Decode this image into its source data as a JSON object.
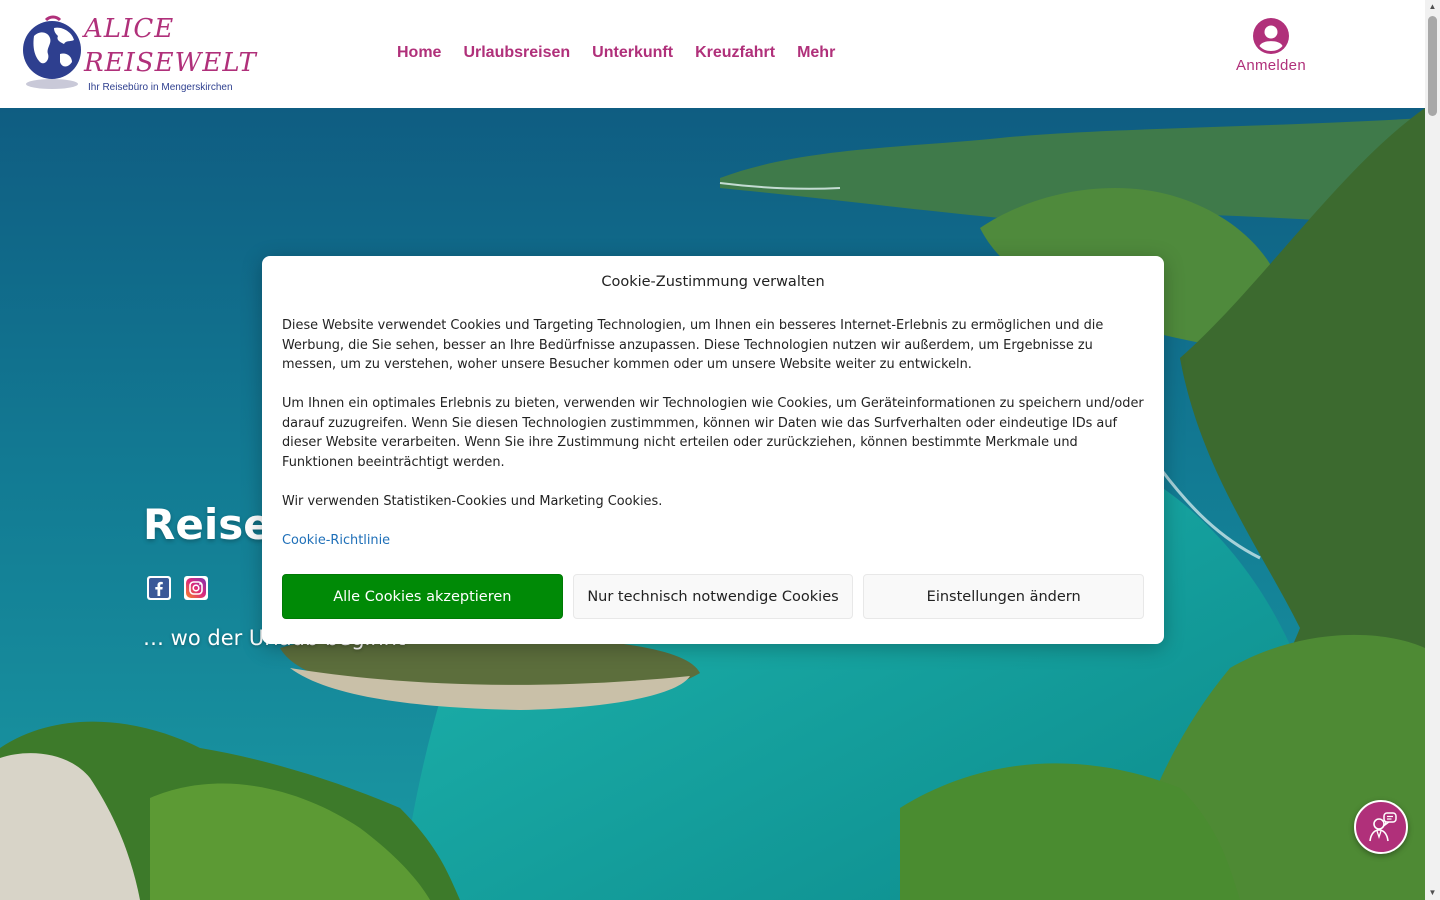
{
  "logo": {
    "line1": "ALICE",
    "line2": "REISEWELT",
    "tagline": "Ihr Reisebüro in Mengerskirchen",
    "icon": "globe-icon"
  },
  "nav": {
    "items": [
      {
        "label": "Home"
      },
      {
        "label": "Urlaubsreisen"
      },
      {
        "label": "Unterkunft"
      },
      {
        "label": "Kreuzfahrt"
      },
      {
        "label": "Mehr"
      }
    ]
  },
  "login": {
    "label": "Anmelden",
    "icon": "user-circle-icon"
  },
  "hero": {
    "title": "Reise",
    "subtitle": "… wo der Urlaub beginnt",
    "social": [
      {
        "icon": "facebook-icon"
      },
      {
        "icon": "instagram-icon"
      }
    ]
  },
  "cookie": {
    "title": "Cookie-Zustimmung verwalten",
    "paragraphs": [
      "Diese Website verwendet Cookies und Targeting Technologien, um Ihnen ein besseres Internet-Erlebnis zu ermöglichen und die Werbung, die Sie sehen, besser an Ihre Bedürfnisse anzupassen. Diese Technologien nutzen wir außerdem, um Ergebnisse zu messen, um zu verstehen, woher unsere Besucher kommen oder um unsere Website weiter zu entwickeln.",
      "Um Ihnen ein optimales Erlebnis zu bieten, verwenden wir Technologien wie Cookies, um Geräteinformationen zu speichern und/oder darauf zuzugreifen. Wenn Sie diesen Technologien zustimmmen, können wir Daten wie das Surfverhalten oder eindeutige IDs auf dieser Website verarbeiten. Wenn Sie ihre Zustimmung nicht erteilen oder zurückziehen, können bestimmte Merkmale und Funktionen beeinträchtigt werden.",
      "Wir verwenden Statistiken-Cookies und Marketing Cookies."
    ],
    "policy_link": "Cookie-Richtlinie",
    "buttons": {
      "accept": "Alle Cookies akzeptieren",
      "deny": "Nur technisch notwendige Cookies",
      "settings": "Einstellungen ändern"
    }
  },
  "chat": {
    "icon": "chat-support-icon"
  },
  "colors": {
    "brand": "#b0307a",
    "brand_dark": "#2e3f8f",
    "accept_button": "#008a06",
    "link": "#1e6fb8"
  }
}
